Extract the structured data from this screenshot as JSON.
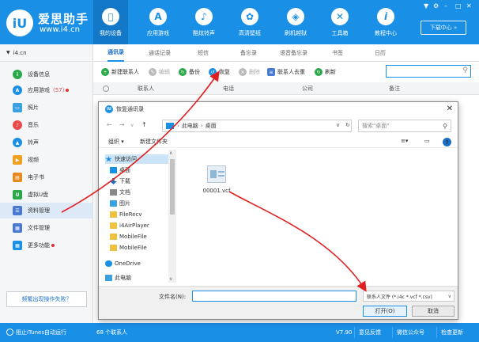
{
  "header": {
    "brand_name": "爱思助手",
    "brand_url": "www.i4.cn",
    "logo_text": "iU",
    "nav": [
      {
        "label": "我的设备",
        "icon": "apple-icon",
        "glyph": ""
      },
      {
        "label": "应用游戏",
        "icon": "app-store-icon",
        "glyph": "A"
      },
      {
        "label": "酷炫铃声",
        "icon": "bell-icon",
        "glyph": "♪"
      },
      {
        "label": "高清壁纸",
        "icon": "flower-icon",
        "glyph": "✿"
      },
      {
        "label": "刷机越狱",
        "icon": "box-icon",
        "glyph": "◈"
      },
      {
        "label": "工具箱",
        "icon": "tools-icon",
        "glyph": "✕"
      },
      {
        "label": "教程中心",
        "icon": "info-icon",
        "glyph": "i"
      }
    ],
    "window_controls": [
      "▼",
      "⚙",
      "–",
      "□",
      "✕"
    ],
    "download_center": "下载中心 »"
  },
  "sidebar": {
    "device": "i4.cn",
    "items": [
      {
        "label": "设备信息",
        "color": "#2aa84a",
        "glyph": "i",
        "dot": false,
        "count": ""
      },
      {
        "label": "应用游戏",
        "color": "#1a8fe6",
        "glyph": "A",
        "dot": true,
        "count": "(57)"
      },
      {
        "label": "照片",
        "color": "#3aa0e0",
        "glyph": "▭",
        "dot": false,
        "count": ""
      },
      {
        "label": "音乐",
        "color": "#e84a4a",
        "glyph": "♪",
        "dot": false,
        "count": ""
      },
      {
        "label": "铃声",
        "color": "#1a8fe6",
        "glyph": "▲",
        "dot": false,
        "count": ""
      },
      {
        "label": "视频",
        "color": "#f0a020",
        "glyph": "▶",
        "dot": false,
        "count": ""
      },
      {
        "label": "电子书",
        "color": "#e88a20",
        "glyph": "▤",
        "dot": false,
        "count": ""
      },
      {
        "label": "虚拟U盘",
        "color": "#2aa84a",
        "glyph": "U",
        "dot": false,
        "count": ""
      },
      {
        "label": "资料管理",
        "color": "#4a7ad0",
        "glyph": "☰",
        "dot": false,
        "count": ""
      },
      {
        "label": "文件管理",
        "color": "#4a7ad0",
        "glyph": "▦",
        "dot": false,
        "count": ""
      },
      {
        "label": "更多功能",
        "color": "#1a8fe6",
        "glyph": "▦",
        "dot": true,
        "count": ""
      }
    ],
    "help_button": "频繁出现操作失败？"
  },
  "main": {
    "tabs": [
      "通讯录",
      "通话记录",
      "短信",
      "备忘录",
      "语音备忘录",
      "书签",
      "日历"
    ],
    "toolbar": [
      {
        "label": "新建联系人",
        "color": "#2aa84a",
        "glyph": "+",
        "disabled": false
      },
      {
        "label": "编辑",
        "color": "#bbb",
        "glyph": "✎",
        "disabled": true
      },
      {
        "label": "备份",
        "color": "#2aa84a",
        "glyph": "↻",
        "disabled": false
      },
      {
        "label": "恢复",
        "color": "#1a8fe6",
        "glyph": "↺",
        "disabled": false
      },
      {
        "label": "删除",
        "color": "#bbb",
        "glyph": "✕",
        "disabled": true
      },
      {
        "label": "联系人去重",
        "color": "#4a7ad0",
        "glyph": "≡",
        "disabled": false
      },
      {
        "label": "刷新",
        "color": "#2aa84a",
        "glyph": "↻",
        "disabled": false
      }
    ],
    "columns": [
      "联系人",
      "电话",
      "公司",
      "备注"
    ]
  },
  "dialog": {
    "title": "恢复通讯录",
    "path": [
      "此电脑",
      "桌面"
    ],
    "search_placeholder": "搜索\"桌面\"",
    "organize": "组织 ▾",
    "new_folder": "新建文件夹",
    "tree": [
      {
        "label": "快速访问",
        "color": "#1a8fe6",
        "pin": false,
        "sel": true
      },
      {
        "label": "桌面",
        "color": "#1a8fe6",
        "pin": true,
        "sel": false
      },
      {
        "label": "下载",
        "color": "#1a6fc8",
        "pin": true,
        "sel": false
      },
      {
        "label": "文档",
        "color": "#888888",
        "pin": true,
        "sel": false
      },
      {
        "label": "图片",
        "color": "#3aa0e0",
        "pin": true,
        "sel": false
      },
      {
        "label": "FileRecv",
        "color": "#f0c040",
        "pin": false,
        "sel": false
      },
      {
        "label": "i4AirPlayer",
        "color": "#f0c040",
        "pin": false,
        "sel": false
      },
      {
        "label": "MobileFile",
        "color": "#f0c040",
        "pin": false,
        "sel": false
      },
      {
        "label": "MobileFile",
        "color": "#f0c040",
        "pin": false,
        "sel": false
      },
      {
        "label": "OneDrive",
        "color": "#1a8fe6",
        "pin": false,
        "sel": false
      },
      {
        "label": "此电脑",
        "color": "#3aa0e0",
        "pin": false,
        "sel": false
      }
    ],
    "file_name": "00001.vcf",
    "filename_label": "文件名(N):",
    "filename_value": "",
    "filter": "联系人文件 (*.i4c *.vcf *.csv)",
    "open_button": "打开(O)",
    "cancel_button": "取消"
  },
  "status": {
    "itunes": "阻止iTunes自动运行",
    "contacts": "68 个联系人",
    "version": "V7.90",
    "feedback": "意见反馈",
    "wechat": "微信公众号",
    "update": "检查更新"
  }
}
